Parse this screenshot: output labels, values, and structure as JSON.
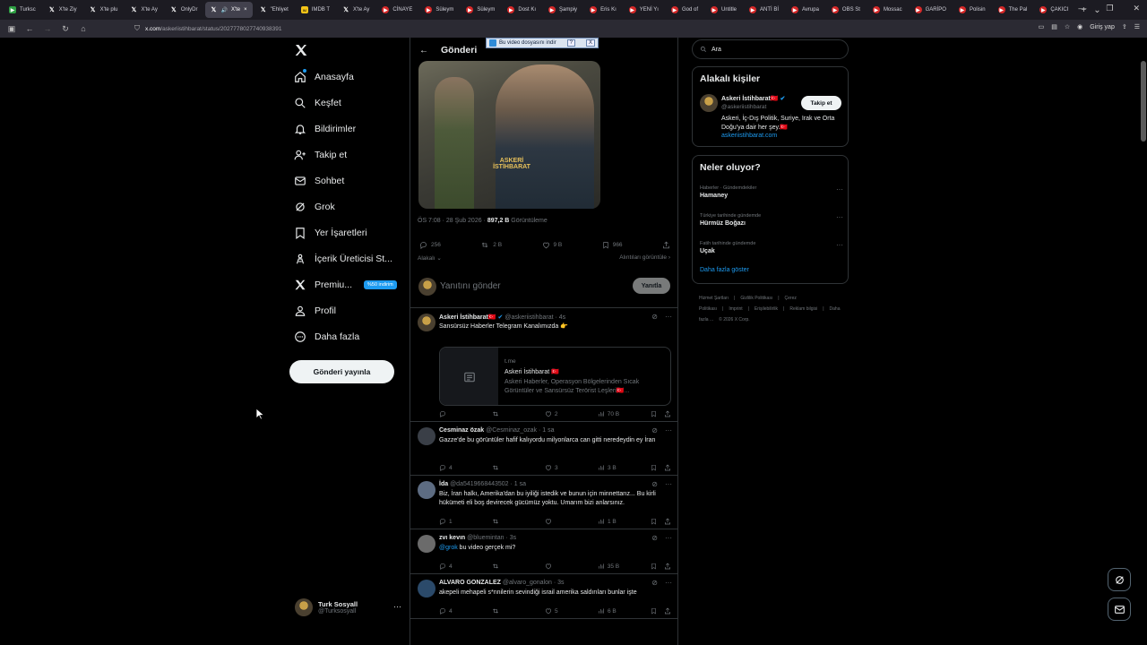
{
  "browser": {
    "tabs": [
      {
        "label": "Turksc",
        "favicon": "green",
        "active": false
      },
      {
        "label": "X'te Ziy",
        "favicon": "x",
        "active": false
      },
      {
        "label": "X'te plu",
        "favicon": "x",
        "active": false
      },
      {
        "label": "X'te Ay",
        "favicon": "x",
        "active": false
      },
      {
        "label": "OnlyDr",
        "favicon": "x",
        "active": false
      },
      {
        "label": "X'te",
        "favicon": "x",
        "active": true
      },
      {
        "label": "\"Ehliyet",
        "favicon": "x",
        "active": false
      },
      {
        "label": "IMDB T",
        "favicon": "imdb",
        "active": false
      },
      {
        "label": "X'te Ay",
        "favicon": "x",
        "active": false
      },
      {
        "label": "CİNAYE",
        "favicon": "red",
        "active": false
      },
      {
        "label": "Süleym",
        "favicon": "red",
        "active": false
      },
      {
        "label": "Süleym",
        "favicon": "red",
        "active": false
      },
      {
        "label": "Dost Kı",
        "favicon": "red",
        "active": false
      },
      {
        "label": "Şampiy",
        "favicon": "red",
        "active": false
      },
      {
        "label": "Eris Kı",
        "favicon": "red",
        "active": false
      },
      {
        "label": "YENİ Yı",
        "favicon": "red",
        "active": false
      },
      {
        "label": "God of",
        "favicon": "red",
        "active": false
      },
      {
        "label": "Untitle",
        "favicon": "red",
        "active": false
      },
      {
        "label": "ANTİ Bİ",
        "favicon": "red",
        "active": false
      },
      {
        "label": "Avrupa",
        "favicon": "red",
        "active": false
      },
      {
        "label": "OBS St",
        "favicon": "red",
        "active": false
      },
      {
        "label": "Mossac",
        "favicon": "red",
        "active": false
      },
      {
        "label": "GARİPO",
        "favicon": "red",
        "active": false
      },
      {
        "label": "Polisin",
        "favicon": "red",
        "active": false
      },
      {
        "label": "The Pal",
        "favicon": "red",
        "active": false
      },
      {
        "label": "ÇAKICI",
        "favicon": "red",
        "active": false
      }
    ],
    "url_domain": "x.com",
    "url_path": "/askeriistihbarat/status/2027778027740938391",
    "signin_label": "Giriş yap"
  },
  "sidebar": {
    "items": [
      {
        "label": "Anasayfa",
        "icon": "home-icon"
      },
      {
        "label": "Keşfet",
        "icon": "search-icon"
      },
      {
        "label": "Bildirimler",
        "icon": "bell-icon"
      },
      {
        "label": "Takip et",
        "icon": "follow-icon"
      },
      {
        "label": "Sohbet",
        "icon": "mail-icon"
      },
      {
        "label": "Grok",
        "icon": "grok-icon"
      },
      {
        "label": "Yer İşaretleri",
        "icon": "bookmark-icon"
      },
      {
        "label": "İçerik Üreticisi St...",
        "icon": "creator-icon"
      },
      {
        "label": "Premiu...",
        "icon": "x-icon",
        "badge": "%50 indirim"
      },
      {
        "label": "Profil",
        "icon": "profile-icon"
      },
      {
        "label": "Daha fazla",
        "icon": "more-icon"
      }
    ],
    "post_button": "Gönderi yayınla",
    "account_name": "Turk Sosyall",
    "account_handle": "@Turksosyall"
  },
  "main": {
    "header_title": "Gönderi",
    "download_bar": {
      "label": "Bu video dosyasını indir",
      "help": "?",
      "close": "X"
    },
    "watermark": "ASKERİ İSTİHBARAT",
    "meta_time": "ÖS 7:08 · 28 Şub 2026 · ",
    "meta_views": "897,2 B",
    "meta_views_label": " Görüntüleme",
    "stats": {
      "replies": "256",
      "reposts": "2 B",
      "likes": "9 B",
      "bookmarks": "966"
    },
    "related_label": "Alakalı",
    "related_views_label": "Alıntıları görüntüle",
    "reply_placeholder": "Yanıtını gönder",
    "reply_button": "Yanıtla",
    "posts": [
      {
        "name": "Askeri İstihbarat🇹🇷",
        "handle": "@askeriistihbarat · 4s",
        "text": "Sansürsüz Haberler Telegram Kanalımızda 👉",
        "card": {
          "domain": "t.me",
          "title": "Askeri İstihbarat 🇹🇷",
          "desc": "Askeri Haberler, Operasyon Bölgelerinden Sıcak Görüntüler ve Sansürsüz Terörist Leşleri🇹🇷..."
        },
        "replies": "",
        "reposts": "",
        "likes": "2",
        "views": "70 B"
      },
      {
        "name": "Cesminaz özak",
        "handle": "@Cesminaz_ozak · 1 sa",
        "text": "Gazze'de bu görüntüler hafif kalıyordu milyonlarca can gitti neredeydin ey İran",
        "replies": "4",
        "reposts": "",
        "likes": "3",
        "views": "3 B"
      },
      {
        "name": "İda",
        "handle": "@da5419668443502 · 1 sa",
        "text": "Biz, İran halkı, Amerika'dan bu iyiliği istedik ve bunun için minnettarız... Bu kirli hükümeti eli boş devirecek gücümüz yoktu. Umarım bizi anlarsınız.",
        "replies": "1",
        "reposts": "",
        "likes": "",
        "views": "1 B"
      },
      {
        "name": "zvı kevın",
        "handle": "@bluemintan · 3s",
        "mention": "@grok",
        "text": " bu video gerçek mi?",
        "replies": "4",
        "reposts": "",
        "likes": "",
        "views": "35 B"
      },
      {
        "name": "ALVARO GONZALEZ",
        "handle": "@alvaro_gonalon · 3s",
        "text": "akepeli mehapeli s*nnilerin sevindiği israil amerika saldırıları bunlar işte",
        "replies": "4",
        "reposts": "",
        "likes": "5",
        "views": "6 B"
      }
    ]
  },
  "right": {
    "search_placeholder": "Ara",
    "relevant_title": "Alakalı kişiler",
    "relevant_name": "Askeri İstihbarat🇹🇷",
    "relevant_handle": "@askeriistihbarat",
    "follow_label": "Takip et",
    "relevant_bio": "Askeri, İç-Dış Politik, Suriye, Irak ve Orta Doğu'ya dair her şey.🇹🇷",
    "relevant_link": "askeriistihbarat.com",
    "trending_title": "Neler oluyor?",
    "trends": [
      {
        "category": "Haberler · Gündemdekiler",
        "title": "Hamaney"
      },
      {
        "category": "Türkiye tarihinde gündemde",
        "title": "Hürmüz Boğazı"
      },
      {
        "category": "Fatih tarihinde gündemde",
        "title": "Uçak"
      }
    ],
    "show_more": "Daha fazla göster",
    "footer_links": [
      "Hizmet Şartları",
      "|",
      "Gizlilik Politikası",
      "|",
      "Çerez Politikası",
      "|",
      "Imprint",
      "|",
      "Erişilebilirlik",
      "|",
      "Reklam bilgisi",
      "|",
      "Daha fazla ...",
      "© 2026 X Corp."
    ]
  },
  "colors": {
    "accent": "#1d9bf0",
    "background": "#000000",
    "border": "#2f3336",
    "muted": "#71767b"
  }
}
